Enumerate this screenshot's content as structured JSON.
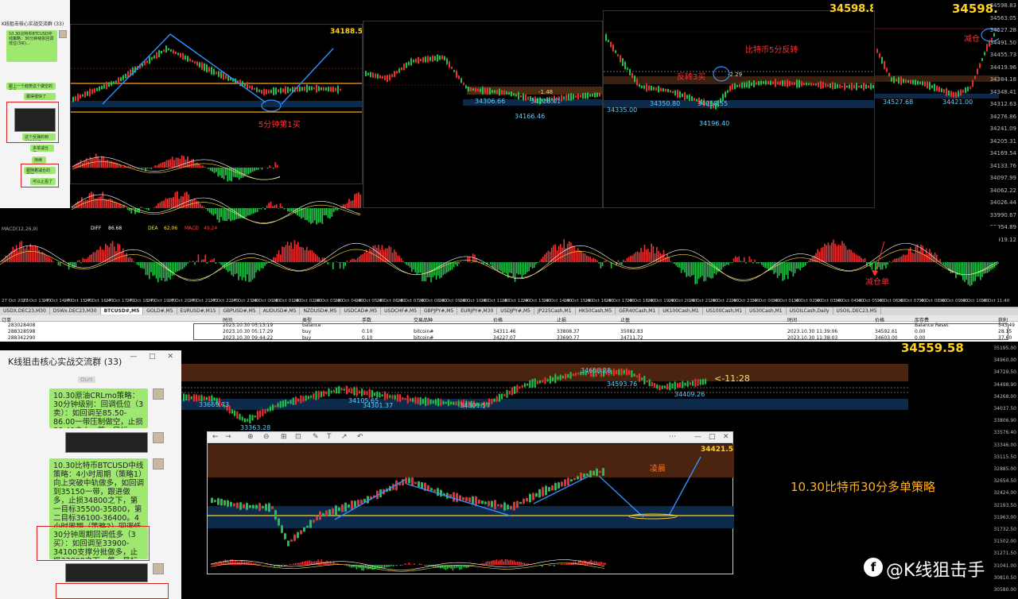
{
  "prices": {
    "top_right": "34598.83",
    "chart1": "34188.53",
    "chart3_partial": "34598.83",
    "bottom_right": "34559.58",
    "inner_chart": "34421.5"
  },
  "annotations": {
    "chart1_buy": "5分钟第1买",
    "chart2_level": "-1.48",
    "chart3_title": "比特币5分反转",
    "chart3_buy": "反转3买",
    "chart3_level": "-2.29",
    "chart4_reduce": "减仓",
    "reduce_order": "减仓单",
    "bottom_level": "<-11:28",
    "inner_label": "凌晨"
  },
  "small_price_labels": {
    "c2_a": "34306.66",
    "c2_b": "34228.01",
    "c2_low": "34166.46",
    "c3_a": "34350.80",
    "c3_b": "34258.55",
    "c3_low": "34196.40",
    "c3_left": "34335.00",
    "c4_a": "34527.68",
    "c4_b": "34421.00",
    "b_a": "33669.73",
    "b_b": "34105.65",
    "b_c": "34301.37",
    "b_d": "34301.57",
    "b_low": "33363.28",
    "b_e": "34409.26",
    "b_f": "34593.76",
    "b_g": "34658.28"
  },
  "chat_top": {
    "title": "K线狙击核心实战交流群 (33)",
    "bubbles": [
      "10.30比特币BTCUSD中线策略：30分钟级别回调低位(3买)…",
      "跟上一个趋势这个做空的机会",
      "跟得很快了",
      "30分钟回调二买已经",
      "这个反弹的到34500了",
      "多单减仓了",
      "持续",
      "跟随着减仓的思路",
      "可以止盈了"
    ],
    "time_label": "11:20"
  },
  "chat_bottom": {
    "title": "K线狙击核心实战交流群 (33)",
    "time_label": "Ourt",
    "bubble1": "10.30原油CRLmo策略：30分钟级别：回调低位（3卖）：如回调至85.50-86.00一带压制做空，止损86.40之上，第一目标84.00-84.50，第二目标83.50-84.00",
    "bubble2": "10.30比特币BTCUSD中线策略：4小时周期（策略1）向上突破中轨做多，如回调到35150一带，跟进做多，止损34800之下，第一目标35500-35800，第二目标36100-36400。4小时周期（策略2）回调低多（3买）：如回调至33300-33700支撑分批做多，止损33100之下，第一目标34500-34800，第二目标35000-35500。",
    "bubble3": "30分钟周期回调低多（3买）：如回调至33900-34100支撑分批做多，止损33800之下，第一目标34400-34600，第二目标35000-35300。"
  },
  "strategy": "10.30比特币30分多单策略",
  "watermark": "@K线狙击手",
  "indicator": {
    "name": "MACD(12,26,9)",
    "diff_label": "DIFF",
    "diff_value": "86.68",
    "dea_label": "DEA",
    "dea_value": "62.06",
    "macd_label": "MACD",
    "macd_value": "49.24"
  },
  "symbol_tabs": [
    "USDX.DEC23,M30",
    "DSWx.DEC23,M30",
    "BTCUSD#,M5",
    "GOLD#,M5",
    "EURUSD#,M15",
    "GBPUSD#,M5",
    "AUDUSD#,M5",
    "NZDUSD#,M5",
    "USDCAD#,M5",
    "USDCHF#,M5",
    "GBPJPY#,M5",
    "EURJPY#,M30",
    "USDJPY#,M5",
    "JP225Cash,M1",
    "HK50Cash,M5",
    "GER40Cash,M1",
    "UK100Cash,M1",
    "US100Cash,M1",
    "US30Cash,M1",
    "USOILCash,Daily",
    "USOIL.DEC23,M5"
  ],
  "active_tab_index": 2,
  "orders_table": {
    "headers": [
      "订单",
      "时间",
      "类型",
      "手数",
      "交易品种",
      "价格",
      "止损",
      "止盈",
      "时间",
      "价格",
      "库存费",
      "获利"
    ],
    "rows": [
      [
        "283028408",
        "2023.10.30 05:13:19",
        "balance",
        "",
        "",
        "",
        "",
        "",
        "",
        "",
        "Balance Reset",
        "543.49"
      ],
      [
        "288328598",
        "2023.10.30 05:17:29",
        "buy",
        "0.10",
        "bitcoin#",
        "34311.46",
        "33808.37",
        "35082.83",
        "2023.10.30 11:39:06",
        "34592.61",
        "0.00",
        "28.15"
      ],
      [
        "288342290",
        "2023.10.30 09:44:22",
        "buy",
        "0.10",
        "bitcoin#",
        "34227.07",
        "33690.77",
        "34711.72",
        "2023.10.30 11:38:03",
        "34603.00",
        "0.00",
        "37.60"
      ]
    ]
  },
  "x_labels": [
    "27 Oct 2023",
    "27 Oct 13:40",
    "27 Oct 14:40",
    "27 Oct 15:40",
    "27 Oct 16:40",
    "27 Oct 17:40",
    "27 Oct 18:40",
    "27 Oct 19:40",
    "27 Oct 20:40",
    "27 Oct 21:40",
    "27 Oct 22:40",
    "27 Oct 23:40",
    "28 Oct 00:40",
    "28 Oct 01:40",
    "28 Oct 02:40",
    "28 Oct 03:40",
    "28 Oct 04:40",
    "28 Oct 05:40",
    "28 Oct 06:40",
    "28 Oct 07:40",
    "28 Oct 08:40",
    "28 Oct 09:40",
    "28 Oct 10:40",
    "28 Oct 11:40",
    "28 Oct 12:40",
    "29 Oct 13:40",
    "29 Oct 14:40",
    "29 Oct 15:40",
    "29 Oct 16:40",
    "29 Oct 17:40",
    "29 Oct 18:40",
    "29 Oct 19:40",
    "29 Oct 20:40",
    "29 Oct 21:40",
    "29 Oct 22:40",
    "29 Oct 23:40",
    "30 Oct 00:40",
    "30 Oct 01:40",
    "30 Oct 02:40",
    "30 Oct 03:40",
    "30 Oct 04:40",
    "30 Oct 05:40",
    "30 Oct 06:40",
    "30 Oct 07:40",
    "30 Oct 08:40",
    "30 Oct 09:40",
    "30 Oct 10:40",
    "30 Oct 11:40"
  ],
  "right_axis_bottom": [
    "35195.00",
    "34960.00",
    "34729.50",
    "34498.90",
    "34268.00",
    "34037.50",
    "33806.90",
    "33576.40",
    "33346.00",
    "33115.50",
    "32885.00",
    "32654.50",
    "32424.00",
    "32193.50",
    "31963.00",
    "31732.50",
    "31502.00",
    "31271.50",
    "31041.00",
    "30810.50",
    "30580.00"
  ],
  "right_axis_top": [
    "34598.83",
    "34563.05",
    "34527.28",
    "34491.50",
    "34455.73",
    "34419.96",
    "34384.18",
    "34348.41",
    "34312.63",
    "34276.86",
    "34241.09",
    "34205.31",
    "34169.54",
    "34133.76",
    "34097.99",
    "34062.22",
    "34026.44",
    "33990.67",
    "33954.89",
    "33919.12"
  ]
}
